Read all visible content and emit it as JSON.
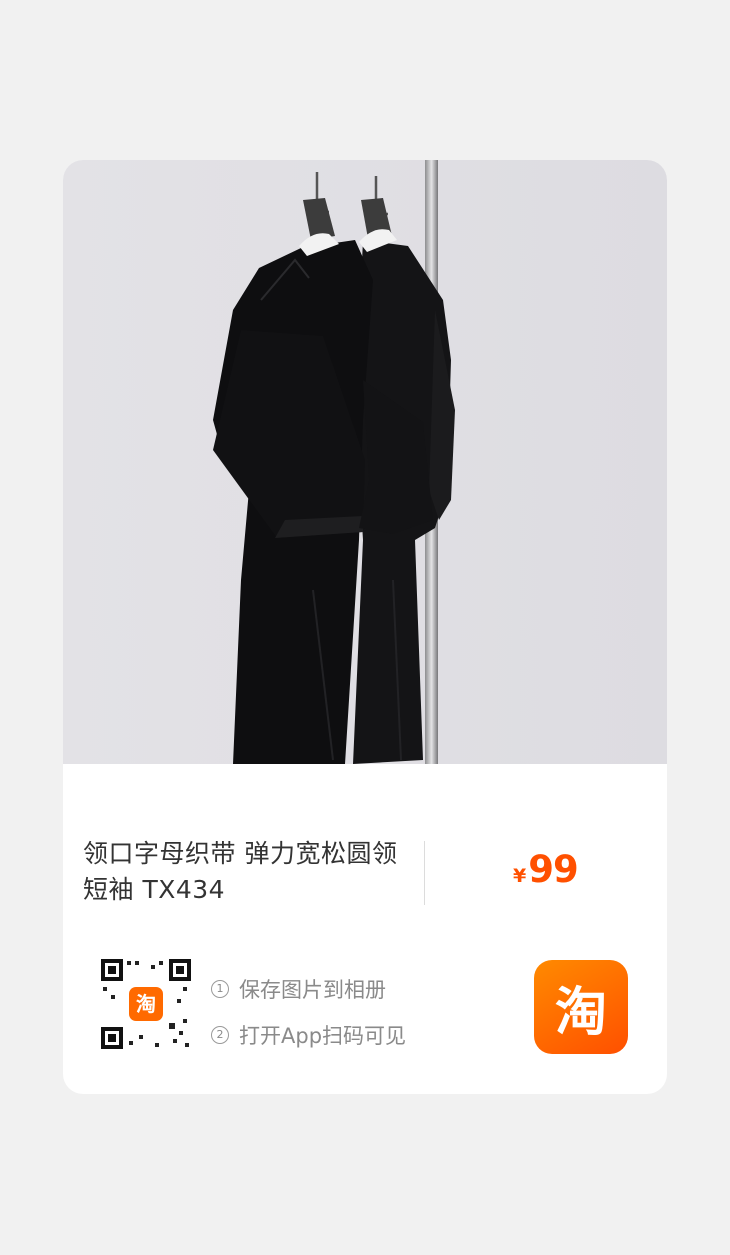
{
  "product": {
    "image_alt": "两件黑色短袖T恤挂在衣架上",
    "title": "领口字母织带 弹力宽松圆领短袖 TX434",
    "price_currency": "¥",
    "price_value": "99"
  },
  "share": {
    "qr_logo_text": "淘",
    "step1_num": "1",
    "step1_text": "保存图片到相册",
    "step2_num": "2",
    "step2_text": "打开App扫码可见",
    "app_icon_text": "淘"
  },
  "colors": {
    "accent": "#ff5000",
    "background": "#f1f1f1",
    "card": "#ffffff"
  }
}
